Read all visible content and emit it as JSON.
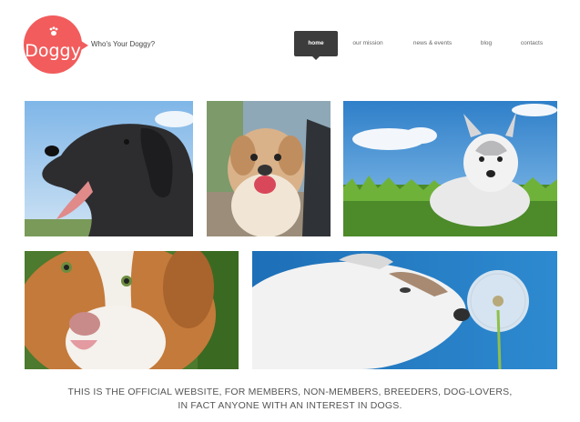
{
  "site": {
    "brand": "Doggy",
    "tagline": "Who's Your Doggy?",
    "logo_icon": "paw-icon",
    "accent_color": "#f25c5c"
  },
  "nav": {
    "items": [
      {
        "label": "home",
        "active": true
      },
      {
        "label": "our mission",
        "active": false
      },
      {
        "label": "news & events",
        "active": false
      },
      {
        "label": "blog",
        "active": false
      },
      {
        "label": "contacts",
        "active": false
      }
    ]
  },
  "gallery": {
    "photos": [
      "dog-photo-pointer",
      "dog-photo-shihtzu",
      "dog-photo-husky-puppy-grass",
      "dog-photo-australian-shepherd-puppy",
      "dog-photo-puppy-dandelion"
    ]
  },
  "footer": {
    "line1": "THIS IS THE OFFICIAL  WEBSITE, FOR MEMBERS, NON-MEMBERS, BREEDERS, DOG-LOVERS,",
    "line2": "IN FACT ANYONE WITH AN INTEREST IN DOGS."
  }
}
